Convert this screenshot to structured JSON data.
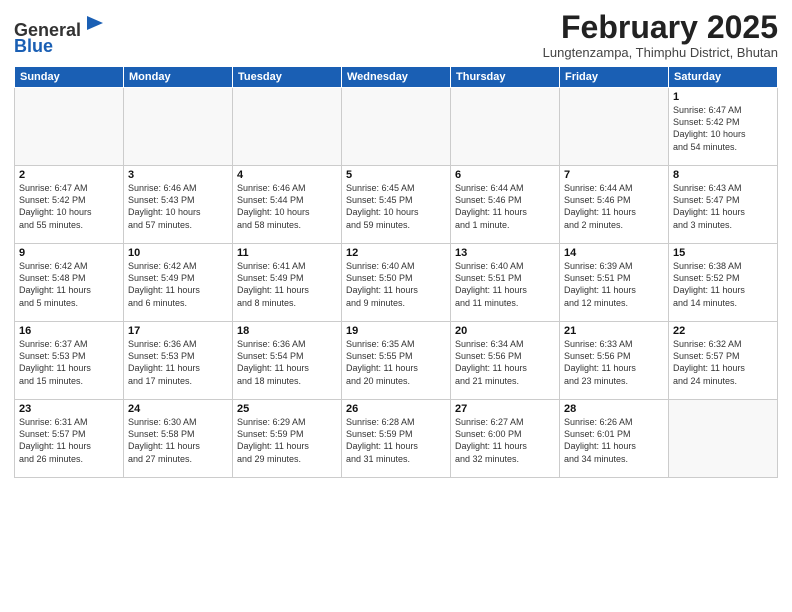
{
  "header": {
    "logo_general": "General",
    "logo_blue": "Blue",
    "month_title": "February 2025",
    "location": "Lungtenzampa, Thimphu District, Bhutan"
  },
  "weekdays": [
    "Sunday",
    "Monday",
    "Tuesday",
    "Wednesday",
    "Thursday",
    "Friday",
    "Saturday"
  ],
  "weeks": [
    [
      {
        "day": "",
        "info": ""
      },
      {
        "day": "",
        "info": ""
      },
      {
        "day": "",
        "info": ""
      },
      {
        "day": "",
        "info": ""
      },
      {
        "day": "",
        "info": ""
      },
      {
        "day": "",
        "info": ""
      },
      {
        "day": "1",
        "info": "Sunrise: 6:47 AM\nSunset: 5:42 PM\nDaylight: 10 hours\nand 54 minutes."
      }
    ],
    [
      {
        "day": "2",
        "info": "Sunrise: 6:47 AM\nSunset: 5:42 PM\nDaylight: 10 hours\nand 55 minutes."
      },
      {
        "day": "3",
        "info": "Sunrise: 6:46 AM\nSunset: 5:43 PM\nDaylight: 10 hours\nand 57 minutes."
      },
      {
        "day": "4",
        "info": "Sunrise: 6:46 AM\nSunset: 5:44 PM\nDaylight: 10 hours\nand 58 minutes."
      },
      {
        "day": "5",
        "info": "Sunrise: 6:45 AM\nSunset: 5:45 PM\nDaylight: 10 hours\nand 59 minutes."
      },
      {
        "day": "6",
        "info": "Sunrise: 6:44 AM\nSunset: 5:46 PM\nDaylight: 11 hours\nand 1 minute."
      },
      {
        "day": "7",
        "info": "Sunrise: 6:44 AM\nSunset: 5:46 PM\nDaylight: 11 hours\nand 2 minutes."
      },
      {
        "day": "8",
        "info": "Sunrise: 6:43 AM\nSunset: 5:47 PM\nDaylight: 11 hours\nand 3 minutes."
      }
    ],
    [
      {
        "day": "9",
        "info": "Sunrise: 6:42 AM\nSunset: 5:48 PM\nDaylight: 11 hours\nand 5 minutes."
      },
      {
        "day": "10",
        "info": "Sunrise: 6:42 AM\nSunset: 5:49 PM\nDaylight: 11 hours\nand 6 minutes."
      },
      {
        "day": "11",
        "info": "Sunrise: 6:41 AM\nSunset: 5:49 PM\nDaylight: 11 hours\nand 8 minutes."
      },
      {
        "day": "12",
        "info": "Sunrise: 6:40 AM\nSunset: 5:50 PM\nDaylight: 11 hours\nand 9 minutes."
      },
      {
        "day": "13",
        "info": "Sunrise: 6:40 AM\nSunset: 5:51 PM\nDaylight: 11 hours\nand 11 minutes."
      },
      {
        "day": "14",
        "info": "Sunrise: 6:39 AM\nSunset: 5:51 PM\nDaylight: 11 hours\nand 12 minutes."
      },
      {
        "day": "15",
        "info": "Sunrise: 6:38 AM\nSunset: 5:52 PM\nDaylight: 11 hours\nand 14 minutes."
      }
    ],
    [
      {
        "day": "16",
        "info": "Sunrise: 6:37 AM\nSunset: 5:53 PM\nDaylight: 11 hours\nand 15 minutes."
      },
      {
        "day": "17",
        "info": "Sunrise: 6:36 AM\nSunset: 5:53 PM\nDaylight: 11 hours\nand 17 minutes."
      },
      {
        "day": "18",
        "info": "Sunrise: 6:36 AM\nSunset: 5:54 PM\nDaylight: 11 hours\nand 18 minutes."
      },
      {
        "day": "19",
        "info": "Sunrise: 6:35 AM\nSunset: 5:55 PM\nDaylight: 11 hours\nand 20 minutes."
      },
      {
        "day": "20",
        "info": "Sunrise: 6:34 AM\nSunset: 5:56 PM\nDaylight: 11 hours\nand 21 minutes."
      },
      {
        "day": "21",
        "info": "Sunrise: 6:33 AM\nSunset: 5:56 PM\nDaylight: 11 hours\nand 23 minutes."
      },
      {
        "day": "22",
        "info": "Sunrise: 6:32 AM\nSunset: 5:57 PM\nDaylight: 11 hours\nand 24 minutes."
      }
    ],
    [
      {
        "day": "23",
        "info": "Sunrise: 6:31 AM\nSunset: 5:57 PM\nDaylight: 11 hours\nand 26 minutes."
      },
      {
        "day": "24",
        "info": "Sunrise: 6:30 AM\nSunset: 5:58 PM\nDaylight: 11 hours\nand 27 minutes."
      },
      {
        "day": "25",
        "info": "Sunrise: 6:29 AM\nSunset: 5:59 PM\nDaylight: 11 hours\nand 29 minutes."
      },
      {
        "day": "26",
        "info": "Sunrise: 6:28 AM\nSunset: 5:59 PM\nDaylight: 11 hours\nand 31 minutes."
      },
      {
        "day": "27",
        "info": "Sunrise: 6:27 AM\nSunset: 6:00 PM\nDaylight: 11 hours\nand 32 minutes."
      },
      {
        "day": "28",
        "info": "Sunrise: 6:26 AM\nSunset: 6:01 PM\nDaylight: 11 hours\nand 34 minutes."
      },
      {
        "day": "",
        "info": ""
      }
    ]
  ]
}
